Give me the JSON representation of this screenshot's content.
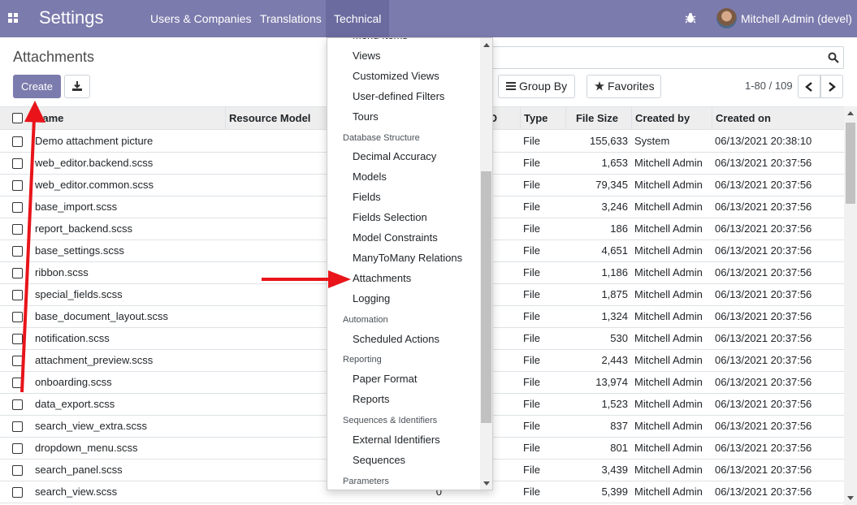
{
  "topbar": {
    "app_name": "Settings",
    "menus": [
      "Users & Companies",
      "Translations",
      "Technical"
    ],
    "active_menu": "Technical",
    "user": "Mitchell Admin (devel)",
    "color": "#7c7bad"
  },
  "control_panel": {
    "breadcrumb": "Attachments",
    "create_label": "Create",
    "group_by_label": "Group By",
    "favorites_label": "Favorites",
    "pager_value": "1-80 / 109"
  },
  "table": {
    "columns": {
      "name": "Name",
      "resource_model": "Resource Model",
      "resource_id": "ID",
      "type": "Type",
      "file_size": "File Size",
      "created_by": "Created by",
      "created_on": "Created on"
    },
    "rows": [
      {
        "name": "Demo attachment picture",
        "type": "File",
        "size": "155,633",
        "by": "System",
        "on": "06/13/2021 20:38:10"
      },
      {
        "name": "web_editor.backend.scss",
        "type": "File",
        "size": "1,653",
        "by": "Mitchell Admin",
        "on": "06/13/2021 20:37:56"
      },
      {
        "name": "web_editor.common.scss",
        "type": "File",
        "size": "79,345",
        "by": "Mitchell Admin",
        "on": "06/13/2021 20:37:56"
      },
      {
        "name": "base_import.scss",
        "type": "File",
        "size": "3,246",
        "by": "Mitchell Admin",
        "on": "06/13/2021 20:37:56"
      },
      {
        "name": "report_backend.scss",
        "type": "File",
        "size": "186",
        "by": "Mitchell Admin",
        "on": "06/13/2021 20:37:56"
      },
      {
        "name": "base_settings.scss",
        "type": "File",
        "size": "4,651",
        "by": "Mitchell Admin",
        "on": "06/13/2021 20:37:56"
      },
      {
        "name": "ribbon.scss",
        "type": "File",
        "size": "1,186",
        "by": "Mitchell Admin",
        "on": "06/13/2021 20:37:56"
      },
      {
        "name": "special_fields.scss",
        "type": "File",
        "size": "1,875",
        "by": "Mitchell Admin",
        "on": "06/13/2021 20:37:56"
      },
      {
        "name": "base_document_layout.scss",
        "type": "File",
        "size": "1,324",
        "by": "Mitchell Admin",
        "on": "06/13/2021 20:37:56"
      },
      {
        "name": "notification.scss",
        "type": "File",
        "size": "530",
        "by": "Mitchell Admin",
        "on": "06/13/2021 20:37:56"
      },
      {
        "name": "attachment_preview.scss",
        "type": "File",
        "size": "2,443",
        "by": "Mitchell Admin",
        "on": "06/13/2021 20:37:56"
      },
      {
        "name": "onboarding.scss",
        "type": "File",
        "size": "13,974",
        "by": "Mitchell Admin",
        "on": "06/13/2021 20:37:56"
      },
      {
        "name": "data_export.scss",
        "type": "File",
        "size": "1,523",
        "by": "Mitchell Admin",
        "on": "06/13/2021 20:37:56"
      },
      {
        "name": "search_view_extra.scss",
        "type": "File",
        "size": "837",
        "by": "Mitchell Admin",
        "on": "06/13/2021 20:37:56"
      },
      {
        "name": "dropdown_menu.scss",
        "type": "File",
        "size": "801",
        "by": "Mitchell Admin",
        "on": "06/13/2021 20:37:56"
      },
      {
        "name": "search_panel.scss",
        "type": "File",
        "size": "3,439",
        "by": "Mitchell Admin",
        "on": "06/13/2021 20:37:56"
      },
      {
        "name": "search_view.scss",
        "resource_id": "0",
        "type": "File",
        "size": "5,399",
        "by": "Mitchell Admin",
        "on": "06/13/2021 20:37:56"
      }
    ]
  },
  "dropdown": {
    "entries": [
      {
        "kind": "item",
        "label": "Menu Items"
      },
      {
        "kind": "item",
        "label": "Views"
      },
      {
        "kind": "item",
        "label": "Customized Views"
      },
      {
        "kind": "item",
        "label": "User-defined Filters"
      },
      {
        "kind": "item",
        "label": "Tours"
      },
      {
        "kind": "header",
        "label": "Database Structure"
      },
      {
        "kind": "item",
        "label": "Decimal Accuracy"
      },
      {
        "kind": "item",
        "label": "Models"
      },
      {
        "kind": "item",
        "label": "Fields"
      },
      {
        "kind": "item",
        "label": "Fields Selection"
      },
      {
        "kind": "item",
        "label": "Model Constraints"
      },
      {
        "kind": "item",
        "label": "ManyToMany Relations"
      },
      {
        "kind": "item",
        "label": "Attachments"
      },
      {
        "kind": "item",
        "label": "Logging"
      },
      {
        "kind": "header",
        "label": "Automation"
      },
      {
        "kind": "item",
        "label": "Scheduled Actions"
      },
      {
        "kind": "header",
        "label": "Reporting"
      },
      {
        "kind": "item",
        "label": "Paper Format"
      },
      {
        "kind": "item",
        "label": "Reports"
      },
      {
        "kind": "header",
        "label": "Sequences & Identifiers"
      },
      {
        "kind": "item",
        "label": "External Identifiers"
      },
      {
        "kind": "item",
        "label": "Sequences"
      },
      {
        "kind": "header",
        "label": "Parameters"
      }
    ]
  },
  "annotations": {
    "arrow_color": "#e8141a"
  }
}
